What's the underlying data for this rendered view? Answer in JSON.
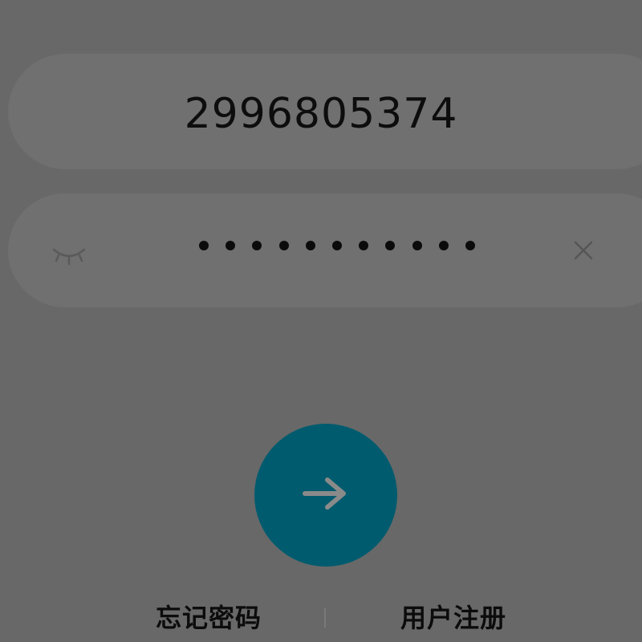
{
  "login": {
    "account_value": "2996805374",
    "password_dot_count": 11,
    "password_visibility_icon": "eye-closed-icon",
    "clear_icon": "close-icon",
    "submit_icon": "arrow-right-icon"
  },
  "links": {
    "forgot_password": "忘记密码",
    "register": "用户注册"
  },
  "colors": {
    "background": "#686868",
    "field": "#707070",
    "submit_button": "#005b6e",
    "submit_arrow": "#8a8a8a"
  }
}
